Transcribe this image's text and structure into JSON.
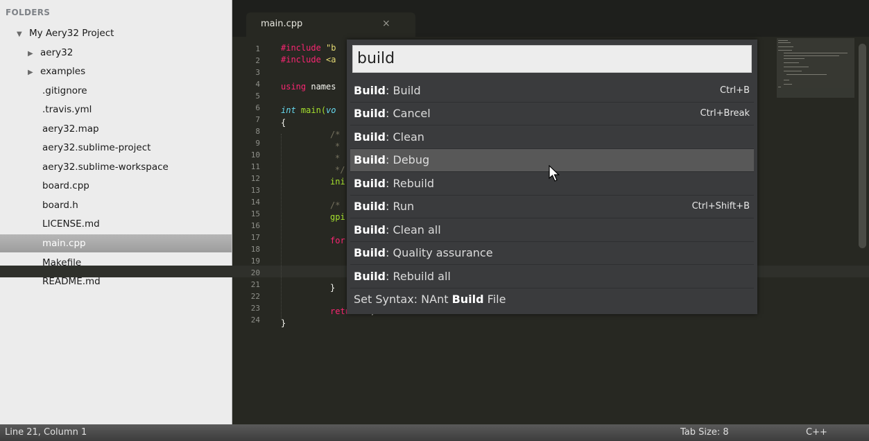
{
  "sidebar": {
    "header": "FOLDERS",
    "project": "My Aery32 Project",
    "folders": [
      "aery32",
      "examples"
    ],
    "files": [
      ".gitignore",
      ".travis.yml",
      "aery32.map",
      "aery32.sublime-project",
      "aery32.sublime-workspace",
      "board.cpp",
      "board.h",
      "LICENSE.md",
      "main.cpp",
      "Makefile",
      "README.md"
    ],
    "active_file": "main.cpp"
  },
  "tab": {
    "label": "main.cpp",
    "close": "×"
  },
  "gutter": [
    "1",
    "2",
    "3",
    "4",
    "5",
    "6",
    "7",
    "8",
    "9",
    "10",
    "11",
    "12",
    "13",
    "14",
    "15",
    "16",
    "17",
    "18",
    "19",
    "20",
    "21",
    "22",
    "23",
    "24"
  ],
  "code": {
    "l1_a": "#include",
    "l1_b": "\"b",
    "l2_a": "#include",
    "l2_b": "<a",
    "l4_a": "using",
    "l4_b": "names",
    "l6_a": "int",
    "l6_b": "main(",
    "l6_c": "vo",
    "l7": "{",
    "l8": "/*",
    "l9": "*",
    "l10": "*",
    "l11": "*/",
    "l12": "ini",
    "l14": "/*",
    "l15": "gpi",
    "l17": "for",
    "l20": "}",
    "l22_a": "return",
    "l22_b": "0",
    "l22_c": ";",
    "l23": "}"
  },
  "palette": {
    "query": "build",
    "items": [
      {
        "bold": "Build",
        "rest": ": Build",
        "shortcut": "Ctrl+B"
      },
      {
        "bold": "Build",
        "rest": ": Cancel",
        "shortcut": "Ctrl+Break"
      },
      {
        "bold": "Build",
        "rest": ": Clean",
        "shortcut": ""
      },
      {
        "bold": "Build",
        "rest": ": Debug",
        "shortcut": ""
      },
      {
        "bold": "Build",
        "rest": ": Rebuild",
        "shortcut": ""
      },
      {
        "bold": "Build",
        "rest": ": Run",
        "shortcut": "Ctrl+Shift+B"
      },
      {
        "bold": "Build",
        "rest": ": Clean all",
        "shortcut": ""
      },
      {
        "bold": "Build",
        "rest": ": Quality assurance",
        "shortcut": ""
      },
      {
        "bold": "Build",
        "rest": ": Rebuild all",
        "shortcut": ""
      }
    ],
    "last_item": {
      "pre": "Set Syntax: NAnt ",
      "bold": "Build",
      "post": " File"
    },
    "selected_index": 3
  },
  "status": {
    "position": "Line 21, Column 1",
    "tab_size": "Tab Size: 8",
    "syntax": "C++"
  }
}
